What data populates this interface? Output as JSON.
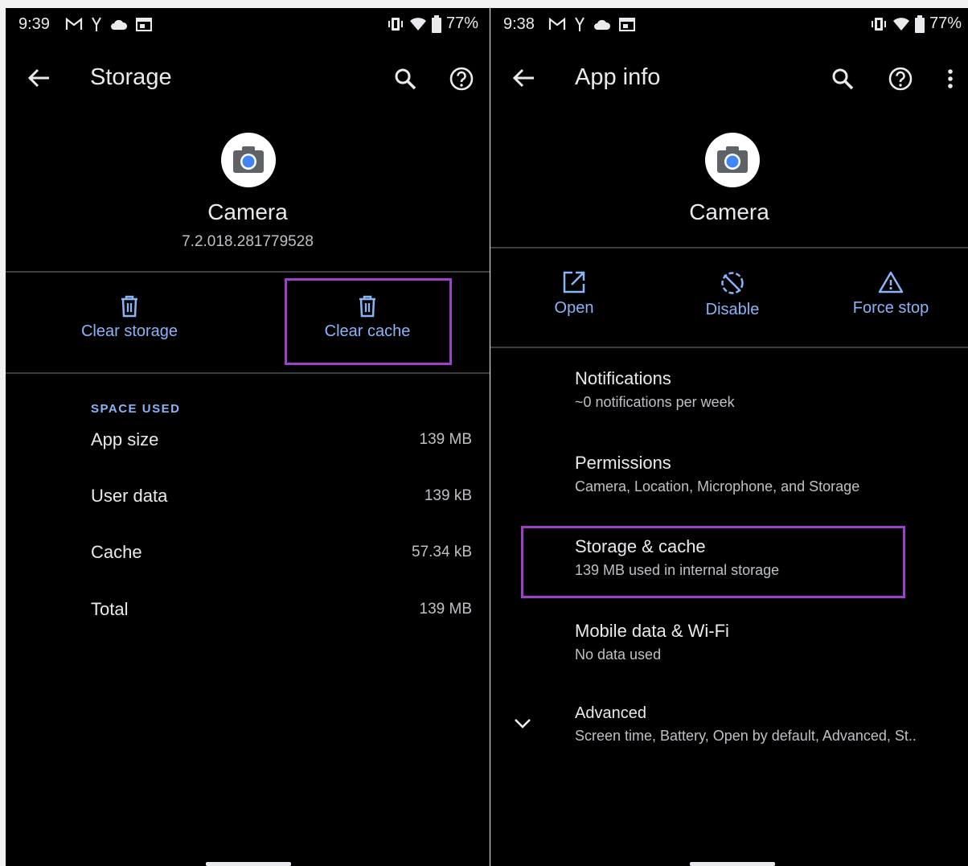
{
  "left": {
    "status": {
      "time": "9:39",
      "battery": "77%"
    },
    "title": "Storage",
    "app_name": "Camera",
    "version": "7.2.018.281779528",
    "actions": {
      "clear_storage": "Clear storage",
      "clear_cache": "Clear cache"
    },
    "section_label": "SPACE USED",
    "rows": [
      {
        "label": "App size",
        "value": "139 MB"
      },
      {
        "label": "User data",
        "value": "139 kB"
      },
      {
        "label": "Cache",
        "value": "57.34 kB"
      },
      {
        "label": "Total",
        "value": "139 MB"
      }
    ]
  },
  "right": {
    "status": {
      "time": "9:38",
      "battery": "77%"
    },
    "title": "App info",
    "app_name": "Camera",
    "actions": {
      "open": "Open",
      "disable": "Disable",
      "force_stop": "Force stop"
    },
    "items": [
      {
        "title": "Notifications",
        "subtitle": "~0 notifications per week"
      },
      {
        "title": "Permissions",
        "subtitle": "Camera, Location, Microphone, and Storage"
      },
      {
        "title": "Storage & cache",
        "subtitle": "139 MB used in internal storage"
      },
      {
        "title": "Mobile data & Wi-Fi",
        "subtitle": "No data used"
      },
      {
        "title": "Advanced",
        "subtitle": "Screen time, Battery, Open by default, Advanced, St.."
      }
    ]
  },
  "colors": {
    "accent": "#8ab4f8",
    "highlight": "#9c3fc9",
    "background": "#000000"
  },
  "icons": [
    "back-arrow-icon",
    "search-icon",
    "help-icon",
    "more-vert-icon",
    "camera-app-icon",
    "trash-icon",
    "open-external-icon",
    "disable-icon",
    "warning-icon",
    "chevron-down-icon"
  ]
}
